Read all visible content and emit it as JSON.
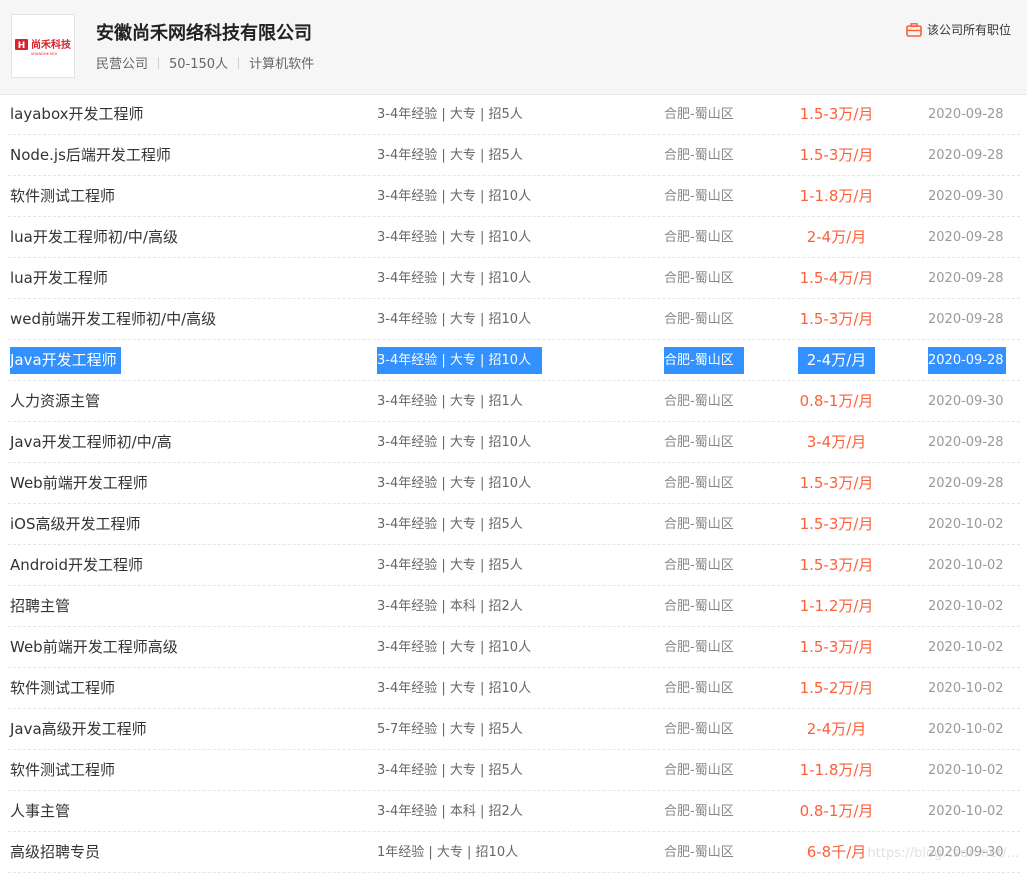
{
  "company": {
    "name": "安徽尚禾网络科技有限公司",
    "logo_text": "尚禾科技",
    "logo_sub": "SHANGHE KEJI",
    "type": "民营公司",
    "size": "50-150人",
    "industry": "计算机软件",
    "all_jobs_label": "该公司所有职位"
  },
  "jobs": [
    {
      "title": "layabox开发工程师",
      "req": "3-4年经验 | 大专 | 招5人",
      "loc": "合肥-蜀山区",
      "salary": "1.5-3万/月",
      "date": "2020-09-28"
    },
    {
      "title": "Node.js后端开发工程师",
      "req": "3-4年经验 | 大专 | 招5人",
      "loc": "合肥-蜀山区",
      "salary": "1.5-3万/月",
      "date": "2020-09-28"
    },
    {
      "title": "软件测试工程师",
      "req": "3-4年经验 | 大专 | 招10人",
      "loc": "合肥-蜀山区",
      "salary": "1-1.8万/月",
      "date": "2020-09-30"
    },
    {
      "title": "lua开发工程师初/中/高级",
      "req": "3-4年经验 | 大专 | 招10人",
      "loc": "合肥-蜀山区",
      "salary": "2-4万/月",
      "date": "2020-09-28"
    },
    {
      "title": "lua开发工程师",
      "req": "3-4年经验 | 大专 | 招10人",
      "loc": "合肥-蜀山区",
      "salary": "1.5-4万/月",
      "date": "2020-09-28"
    },
    {
      "title": "wed前端开发工程师初/中/高级",
      "req": "3-4年经验 | 大专 | 招10人",
      "loc": "合肥-蜀山区",
      "salary": "1.5-3万/月",
      "date": "2020-09-28"
    },
    {
      "title": "Java开发工程师",
      "req": "3-4年经验 | 大专 | 招10人",
      "loc": "合肥-蜀山区",
      "salary": "2-4万/月",
      "date": "2020-09-28",
      "selected": true
    },
    {
      "title": "人力资源主管",
      "req": "3-4年经验 | 大专 | 招1人",
      "loc": "合肥-蜀山区",
      "salary": "0.8-1万/月",
      "date": "2020-09-30"
    },
    {
      "title": "Java开发工程师初/中/高",
      "req": "3-4年经验 | 大专 | 招10人",
      "loc": "合肥-蜀山区",
      "salary": "3-4万/月",
      "date": "2020-09-28"
    },
    {
      "title": "Web前端开发工程师",
      "req": "3-4年经验 | 大专 | 招10人",
      "loc": "合肥-蜀山区",
      "salary": "1.5-3万/月",
      "date": "2020-09-28"
    },
    {
      "title": "iOS高级开发工程师",
      "req": "3-4年经验 | 大专 | 招5人",
      "loc": "合肥-蜀山区",
      "salary": "1.5-3万/月",
      "date": "2020-10-02"
    },
    {
      "title": "Android开发工程师",
      "req": "3-4年经验 | 大专 | 招5人",
      "loc": "合肥-蜀山区",
      "salary": "1.5-3万/月",
      "date": "2020-10-02"
    },
    {
      "title": "招聘主管",
      "req": "3-4年经验 | 本科 | 招2人",
      "loc": "合肥-蜀山区",
      "salary": "1-1.2万/月",
      "date": "2020-10-02"
    },
    {
      "title": "Web前端开发工程师高级",
      "req": "3-4年经验 | 大专 | 招10人",
      "loc": "合肥-蜀山区",
      "salary": "1.5-3万/月",
      "date": "2020-10-02"
    },
    {
      "title": "软件测试工程师",
      "req": "3-4年经验 | 大专 | 招10人",
      "loc": "合肥-蜀山区",
      "salary": "1.5-2万/月",
      "date": "2020-10-02"
    },
    {
      "title": "Java高级开发工程师",
      "req": "5-7年经验 | 大专 | 招5人",
      "loc": "合肥-蜀山区",
      "salary": "2-4万/月",
      "date": "2020-10-02"
    },
    {
      "title": "软件测试工程师",
      "req": "3-4年经验 | 大专 | 招5人",
      "loc": "合肥-蜀山区",
      "salary": "1-1.8万/月",
      "date": "2020-10-02"
    },
    {
      "title": "人事主管",
      "req": "3-4年经验 | 本科 | 招2人",
      "loc": "合肥-蜀山区",
      "salary": "0.8-1万/月",
      "date": "2020-10-02"
    },
    {
      "title": "高级招聘专员",
      "req": "1年经验 | 大专 | 招10人",
      "loc": "合肥-蜀山区",
      "salary": "6-8千/月",
      "date": "2020-09-30"
    }
  ],
  "watermark": "https://blog.csdn.net/...",
  "colors": {
    "accent": "#fd5f39",
    "selection": "#3390ff",
    "logo_red": "#d9232d"
  }
}
